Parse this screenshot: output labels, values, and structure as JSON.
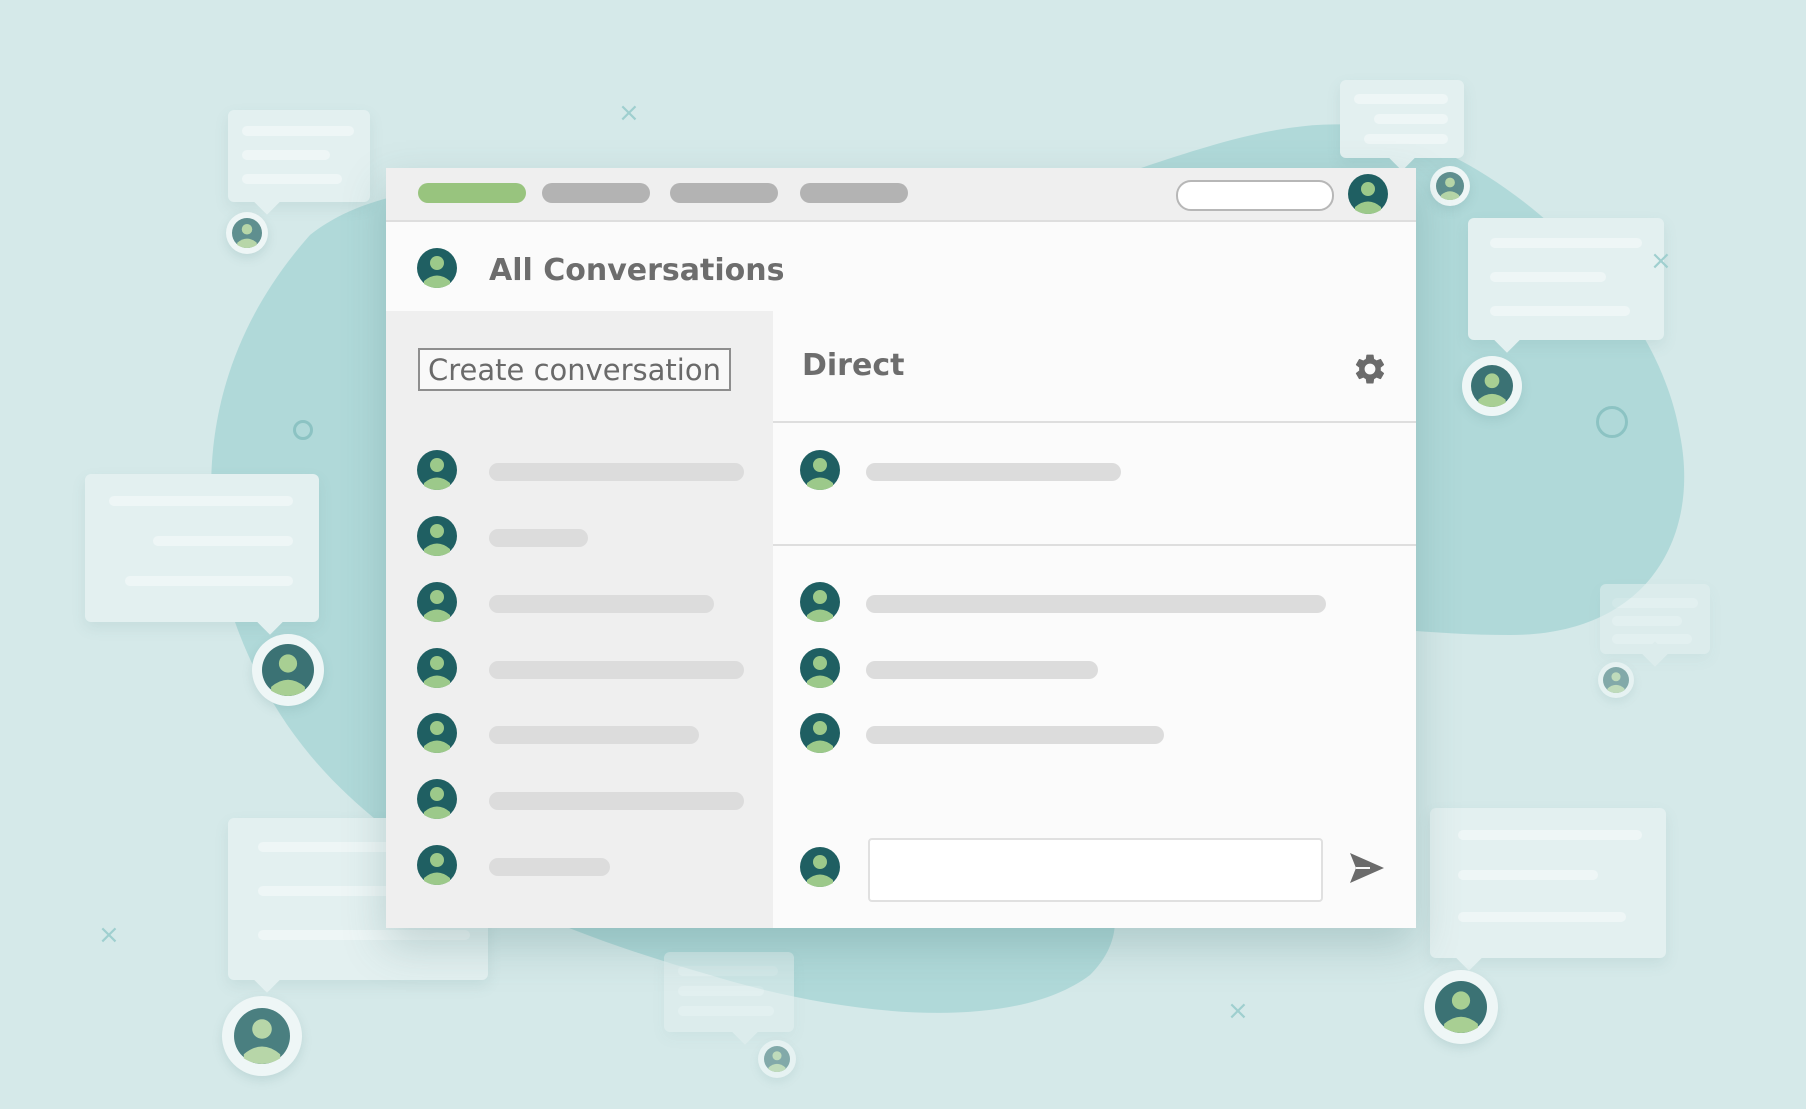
{
  "colors": {
    "background": "#d5e9e9",
    "blob": "#a9d6d6",
    "accent_tab": "#98c47e",
    "avatar_dark": "#2f6a6c",
    "avatar_light": "#9cc98a"
  },
  "nav": {
    "tabs": [
      {
        "state": "active"
      },
      {
        "state": "inactive"
      },
      {
        "state": "inactive"
      },
      {
        "state": "inactive"
      }
    ],
    "search_icon": "none",
    "profile_icon": "user-avatar-icon"
  },
  "header": {
    "title": "All Conversations",
    "icon": "user-avatar-icon"
  },
  "sidebar": {
    "create_button_label": "Create conversation",
    "conversations": [
      {
        "avatar": "user-avatar-icon",
        "preview": "placeholder"
      },
      {
        "avatar": "user-avatar-icon",
        "preview": "placeholder"
      },
      {
        "avatar": "user-avatar-icon",
        "preview": "placeholder"
      },
      {
        "avatar": "user-avatar-icon",
        "preview": "placeholder"
      },
      {
        "avatar": "user-avatar-icon",
        "preview": "placeholder"
      },
      {
        "avatar": "user-avatar-icon",
        "preview": "placeholder"
      },
      {
        "avatar": "user-avatar-icon",
        "preview": "placeholder"
      }
    ]
  },
  "panel": {
    "title": "Direct",
    "settings_icon": "gear-icon",
    "pinned_message": {
      "avatar": "user-avatar-icon"
    },
    "messages": [
      {
        "avatar": "user-avatar-icon"
      },
      {
        "avatar": "user-avatar-icon"
      },
      {
        "avatar": "user-avatar-icon"
      }
    ],
    "composer": {
      "value": "",
      "placeholder": "",
      "send_icon": "send-icon"
    }
  }
}
